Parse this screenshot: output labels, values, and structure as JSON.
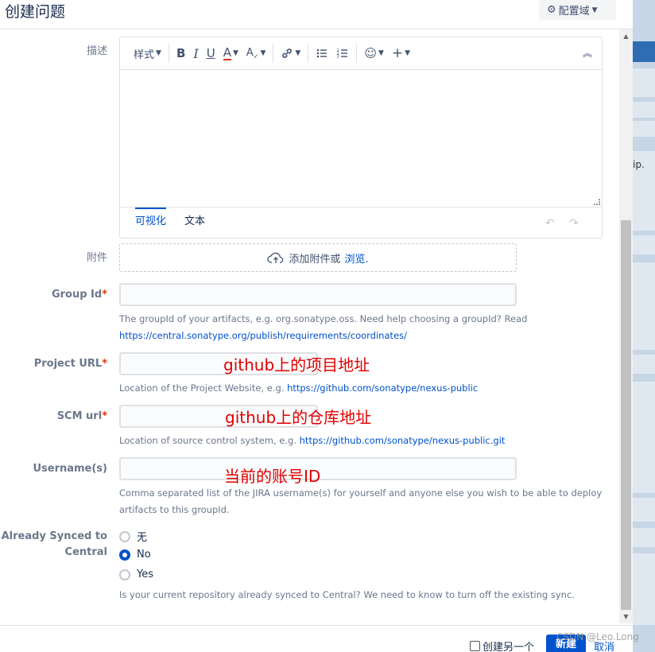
{
  "header": {
    "title": "创建问题",
    "config_button": "配置域"
  },
  "description": {
    "label": "描述",
    "toolbar": {
      "style": "样式",
      "bold": "B",
      "italic": "I",
      "underline": "U",
      "color": "A"
    },
    "mode_tabs": [
      "可视化",
      "文本"
    ]
  },
  "attachment": {
    "label": "附件",
    "text": "添加附件或",
    "link": "浏览."
  },
  "group_id": {
    "label": "Group Id",
    "value": "",
    "help": "The groupId of your artifacts, e.g. org.sonatype.oss. Need help choosing a groupId? Read",
    "help_link": "https://central.sonatype.org/publish/requirements/coordinates/"
  },
  "project_url": {
    "label": "Project URL",
    "value": "",
    "help": "Location of the Project Website, e.g.",
    "help_link": "https://github.com/sonatype/nexus-public",
    "annotation": "github上的项目地址"
  },
  "scm_url": {
    "label": "SCM url",
    "value": "",
    "help": "Location of source control system, e.g.",
    "help_link": "https://github.com/sonatype/nexus-public.git",
    "annotation": "github上的仓库地址"
  },
  "usernames": {
    "label": "Username(s)",
    "value": "",
    "help": "Comma separated list of the JIRA username(s) for yourself and anyone else you wish to be able to deploy artifacts to this groupId.",
    "annotation": "当前的账号ID"
  },
  "already_synced": {
    "label_line1": "Already Synced to",
    "label_line2": "Central",
    "options": [
      "无",
      "No",
      "Yes"
    ],
    "selected": "No",
    "help": "Is your current repository already synced to Central? We need to know to turn off the existing sync."
  },
  "footer": {
    "create_another": "创建另一个",
    "create_button": "新建",
    "cancel": "取消",
    "watermark": "CSDN @Leo.Long"
  },
  "background": {
    "partial_text": "ip."
  },
  "colors": {
    "primary": "#0052cc",
    "required": "#de350b",
    "annotation": "#e00000"
  }
}
